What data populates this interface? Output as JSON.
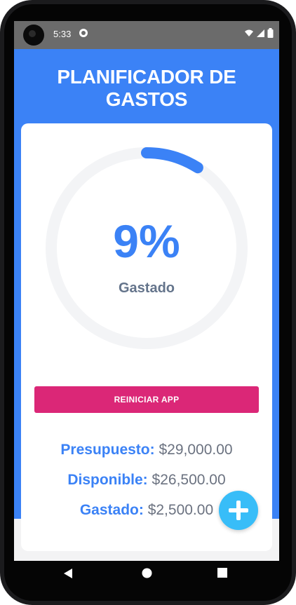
{
  "status_bar": {
    "time": "5:33",
    "icons": [
      "app-notification-icon",
      "wifi-icon",
      "signal-icon",
      "battery-icon"
    ]
  },
  "header": {
    "title": "PLANIFICADOR DE GASTOS"
  },
  "progress": {
    "percent_text": "9%",
    "percent_value": 9,
    "label": "Gastado"
  },
  "actions": {
    "reset_label": "REINICIAR APP"
  },
  "summary": {
    "presupuesto_label": "Presupuesto:",
    "presupuesto_value": "$29,000.00",
    "disponible_label": "Disponible:",
    "disponible_value": "$26,500.00",
    "gastado_label": "Gastado:",
    "gastado_value": "$2,500.00"
  },
  "colors": {
    "primary": "#3b82f6",
    "reset_button": "#db2777",
    "fab": "#38bdf8",
    "track": "#f3f4f6",
    "muted_text": "#64748b"
  },
  "fab_icon": "plus-icon",
  "nav_icons": [
    "back-icon",
    "home-icon",
    "recents-icon"
  ]
}
